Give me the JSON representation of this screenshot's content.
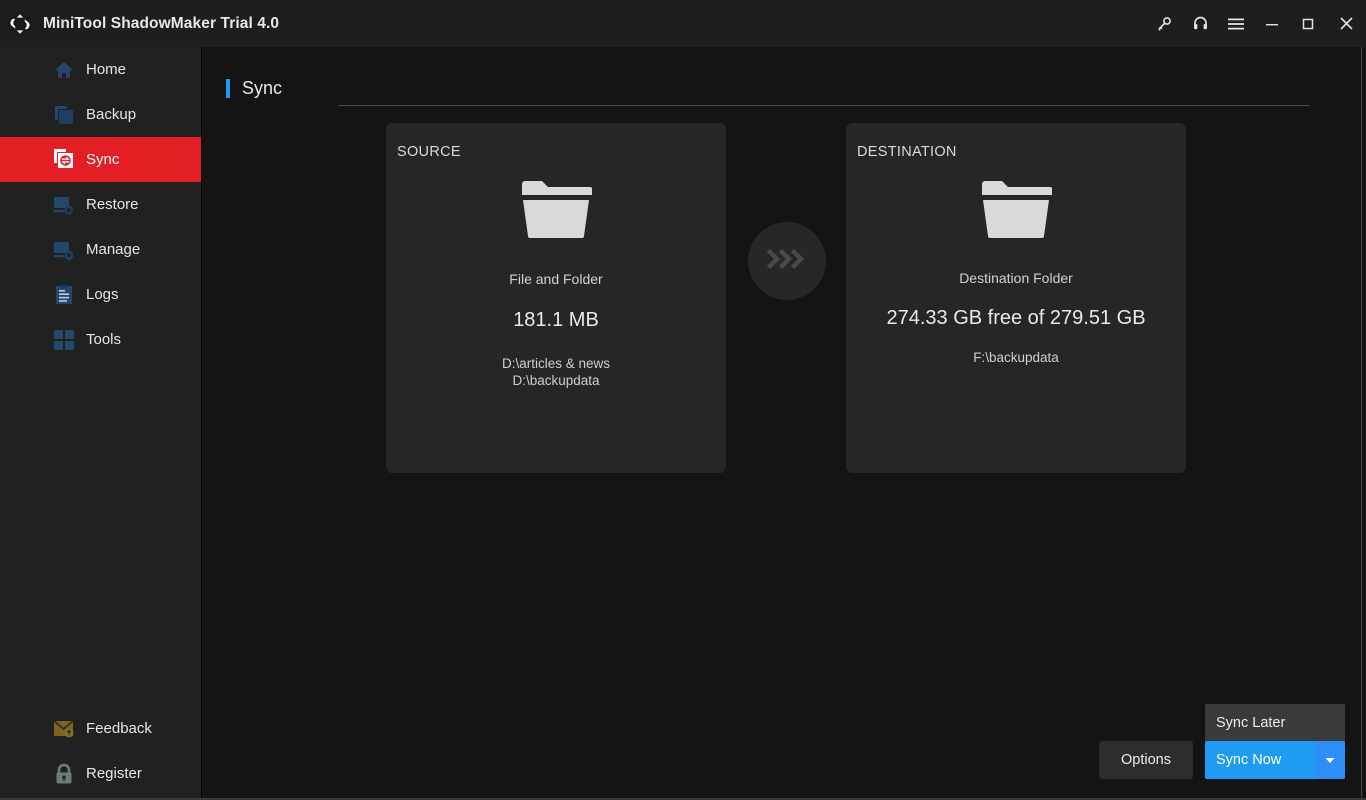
{
  "window": {
    "title": "MiniTool ShadowMaker Trial 4.0",
    "logo_icon": "sync-circle-logo",
    "controls": [
      {
        "name": "key-icon",
        "label": "Key"
      },
      {
        "name": "headset-icon",
        "label": "Support"
      },
      {
        "name": "menu-icon",
        "label": "Menu"
      },
      {
        "name": "minimize-icon",
        "label": "Minimize"
      },
      {
        "name": "maximize-icon",
        "label": "Maximize"
      },
      {
        "name": "close-icon",
        "label": "Close"
      }
    ]
  },
  "sidebar": {
    "items": [
      {
        "label": "Home",
        "icon": "home-icon",
        "active": false
      },
      {
        "label": "Backup",
        "icon": "backup-icon",
        "active": false
      },
      {
        "label": "Sync",
        "icon": "sync-icon",
        "active": true
      },
      {
        "label": "Restore",
        "icon": "restore-icon",
        "active": false
      },
      {
        "label": "Manage",
        "icon": "manage-icon",
        "active": false
      },
      {
        "label": "Logs",
        "icon": "logs-icon",
        "active": false
      },
      {
        "label": "Tools",
        "icon": "tools-icon",
        "active": false
      }
    ],
    "bottom_items": [
      {
        "label": "Feedback",
        "icon": "feedback-envelope-icon"
      },
      {
        "label": "Register",
        "icon": "lock-icon"
      }
    ],
    "active_color": "#e31e24",
    "icon_color": "#24476b"
  },
  "page": {
    "title": "Sync",
    "accent_color": "#1e9cf2"
  },
  "source": {
    "title": "SOURCE",
    "icon": "folder-icon",
    "type_label": "File and Folder",
    "size": "181.1 MB",
    "path_line_1": "D:\\articles & news",
    "path_line_2": "D:\\backupdata"
  },
  "connector": {
    "icon": "triple-chevron-right-icon"
  },
  "destination": {
    "title": "DESTINATION",
    "icon": "folder-icon",
    "type_label": "Destination Folder",
    "capacity": "274.33 GB free of 279.51 GB",
    "path": "F:\\backupdata"
  },
  "actions": {
    "sync_later_label": "Sync Later",
    "options_label": "Options",
    "sync_now_label": "Sync Now",
    "dropdown_icon": "chevron-down-icon",
    "primary_color": "#1e9cf2"
  }
}
